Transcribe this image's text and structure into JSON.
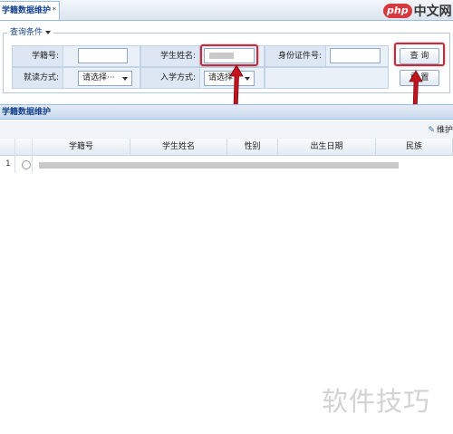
{
  "tab": {
    "title": "学籍数据维护",
    "close": "*"
  },
  "logo": {
    "php": "php",
    "cn": "中文网"
  },
  "query": {
    "legend": "查询条件",
    "student_id_label": "学籍号:",
    "student_name_label": "学生姓名:",
    "id_card_label": "身份证件号:",
    "study_mode_label": "就读方式:",
    "study_mode_value": "请选择···",
    "enroll_mode_label": "入学方式:",
    "enroll_mode_value": "请选择",
    "search_button": "查 询",
    "reset_button": "重 置"
  },
  "panel": {
    "title": "学籍数据维护",
    "toolbar_button": "维护"
  },
  "grid": {
    "columns": [
      "学籍号",
      "学生姓名",
      "性别",
      "出生日期",
      "民族"
    ],
    "rows": [
      {
        "index": "1"
      }
    ]
  },
  "watermark": "软件技巧",
  "colors": {
    "highlight": "#d1253a",
    "header_text": "#15428b"
  }
}
